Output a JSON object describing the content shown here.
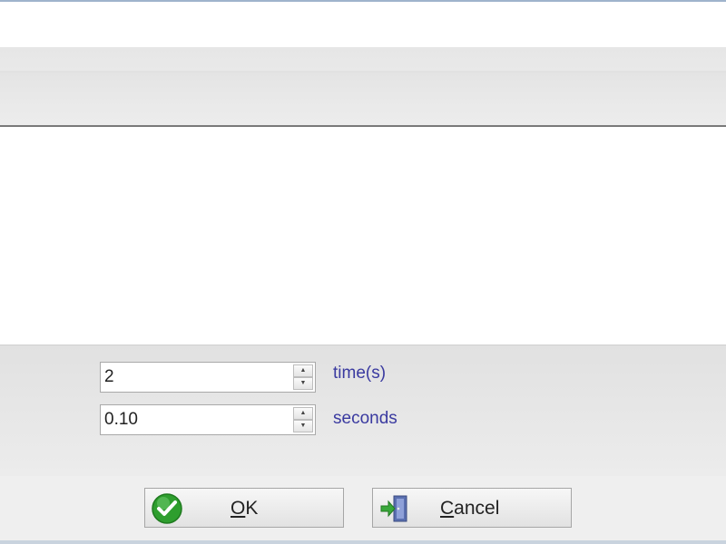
{
  "repeat_field": {
    "value": "2",
    "unit": "time(s)"
  },
  "delay_field": {
    "value": "0.10",
    "unit": "seconds"
  },
  "buttons": {
    "ok": {
      "mnemonic": "O",
      "rest": "K",
      "icon": "green-check-icon"
    },
    "cancel": {
      "mnemonic": "C",
      "rest": "ancel",
      "icon": "exit-door-icon"
    }
  },
  "spinner_glyphs": {
    "up": "▲",
    "down": "▼"
  },
  "colors": {
    "unit_label": "#3a3aa0",
    "ok_icon": "#2e9e2e",
    "cancel_icon_arrow": "#39a83a",
    "cancel_icon_door": "#5a6fb0"
  }
}
